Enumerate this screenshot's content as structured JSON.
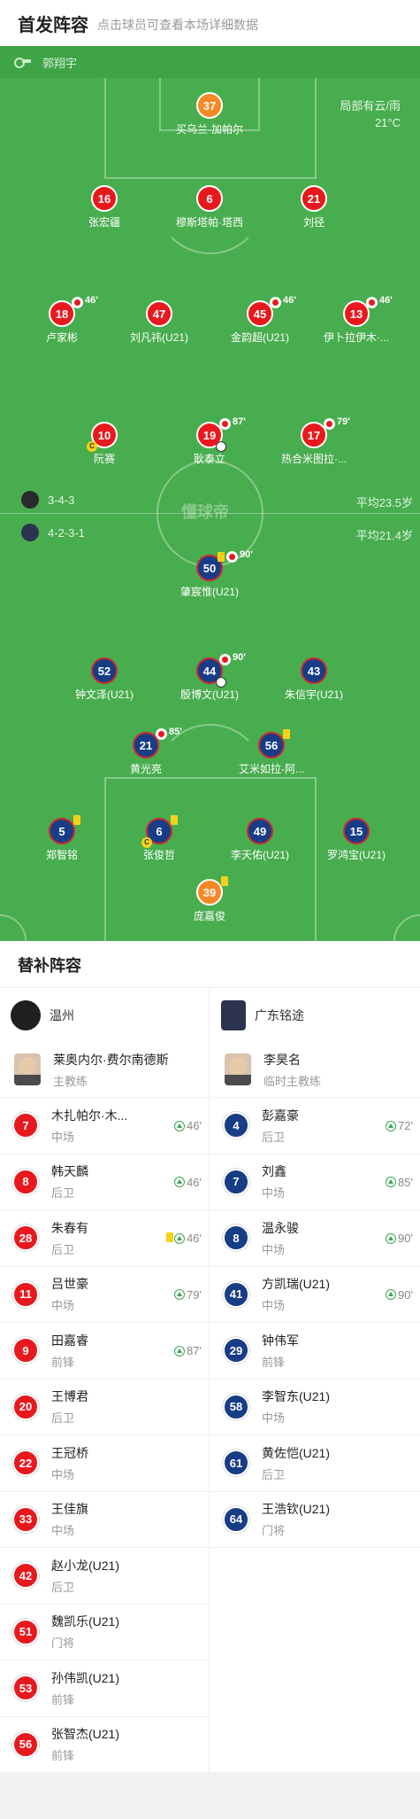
{
  "header": {
    "title": "首发阵容",
    "subtitle": "点击球员可查看本场详细数据"
  },
  "referee": {
    "name": "郭翔宇"
  },
  "weather": {
    "condition": "局部有云/雨",
    "temp": "21°C"
  },
  "watermark": "懂球帝",
  "home": {
    "formation": "3-4-3",
    "avg_age": "平均23.5岁",
    "players": {
      "gk": {
        "num": "37",
        "name": "买乌兰·加帕尔"
      },
      "d1": {
        "num": "16",
        "name": "张宏疆"
      },
      "d2": {
        "num": "6",
        "name": "穆斯塔帕·塔西"
      },
      "d3": {
        "num": "21",
        "name": "刘径"
      },
      "m1": {
        "num": "18",
        "name": "卢家彬",
        "sub": "46'"
      },
      "m2": {
        "num": "47",
        "name": "刘凡祎(U21)"
      },
      "m3": {
        "num": "45",
        "name": "金韵超(U21)",
        "sub": "46'"
      },
      "m4": {
        "num": "13",
        "name": "伊卜拉伊木·...",
        "sub": "46'"
      },
      "f1": {
        "num": "10",
        "name": "阮赛",
        "captain": "C"
      },
      "f2": {
        "num": "19",
        "name": "耿泰立",
        "sub": "87'"
      },
      "f3": {
        "num": "17",
        "name": "热合米图拉·...",
        "sub": "79'"
      }
    }
  },
  "away": {
    "formation": "4-2-3-1",
    "avg_age": "平均21.4岁",
    "players": {
      "f1": {
        "num": "50",
        "name": "肇宸惟(U21)",
        "sub": "90'"
      },
      "am1": {
        "num": "52",
        "name": "钟文泽(U21)"
      },
      "am2": {
        "num": "44",
        "name": "殷博文(U21)",
        "sub": "90'"
      },
      "am3": {
        "num": "43",
        "name": "朱信宇(U21)"
      },
      "dm1": {
        "num": "21",
        "name": "黄光亮",
        "sub": "85'"
      },
      "dm2": {
        "num": "56",
        "name": "艾米如拉-阿..."
      },
      "d1": {
        "num": "5",
        "name": "郑智铭"
      },
      "d2": {
        "num": "6",
        "name": "张俊哲",
        "captain": "C"
      },
      "d3": {
        "num": "49",
        "name": "李天佑(U21)"
      },
      "d4": {
        "num": "15",
        "name": "罗鸿宝(U21)"
      },
      "gk": {
        "num": "39",
        "name": "庞嘉俊"
      }
    }
  },
  "subs": {
    "title": "替补阵容",
    "home_team": "温州",
    "away_team": "广东铭途",
    "home_coach": {
      "name": "莱奥内尔·费尔南德斯",
      "role": "主教练"
    },
    "away_coach": {
      "name": "李昊名",
      "role": "临时主教练"
    },
    "home_list": [
      {
        "num": "7",
        "name": "木扎帕尔·木...",
        "pos": "中场",
        "in": "46'"
      },
      {
        "num": "8",
        "name": "韩天麟",
        "pos": "后卫",
        "in": "46'"
      },
      {
        "num": "28",
        "name": "朱春有",
        "pos": "后卫",
        "in": "46'"
      },
      {
        "num": "11",
        "name": "吕世豪",
        "pos": "中场",
        "in": "79'"
      },
      {
        "num": "9",
        "name": "田嘉睿",
        "pos": "前锋",
        "in": "87'"
      },
      {
        "num": "20",
        "name": "王博君",
        "pos": "后卫",
        "in": ""
      },
      {
        "num": "22",
        "name": "王冠桥",
        "pos": "中场",
        "in": ""
      },
      {
        "num": "33",
        "name": "王佳旗",
        "pos": "中场",
        "in": ""
      },
      {
        "num": "42",
        "name": "赵小龙(U21)",
        "pos": "后卫",
        "in": ""
      },
      {
        "num": "51",
        "name": "魏凯乐(U21)",
        "pos": "门将",
        "in": ""
      },
      {
        "num": "53",
        "name": "孙伟凯(U21)",
        "pos": "前锋",
        "in": ""
      },
      {
        "num": "56",
        "name": "张智杰(U21)",
        "pos": "前锋",
        "in": ""
      }
    ],
    "away_list": [
      {
        "num": "4",
        "name": "彭嘉豪",
        "pos": "后卫",
        "in": "72'"
      },
      {
        "num": "7",
        "name": "刘鑫",
        "pos": "中场",
        "in": "85'"
      },
      {
        "num": "8",
        "name": "温永骏",
        "pos": "中场",
        "in": "90'"
      },
      {
        "num": "41",
        "name": "方凯瑞(U21)",
        "pos": "中场",
        "in": "90'"
      },
      {
        "num": "29",
        "name": "钟伟军",
        "pos": "前锋",
        "in": ""
      },
      {
        "num": "58",
        "name": "李智东(U21)",
        "pos": "中场",
        "in": ""
      },
      {
        "num": "61",
        "name": "黄佐恺(U21)",
        "pos": "后卫",
        "in": ""
      },
      {
        "num": "64",
        "name": "王浩钦(U21)",
        "pos": "门将",
        "in": ""
      }
    ]
  },
  "colors": {
    "home": "#e8191e",
    "away": "#173d86",
    "gk": "#f68825",
    "pitch": "#48ad4e"
  }
}
